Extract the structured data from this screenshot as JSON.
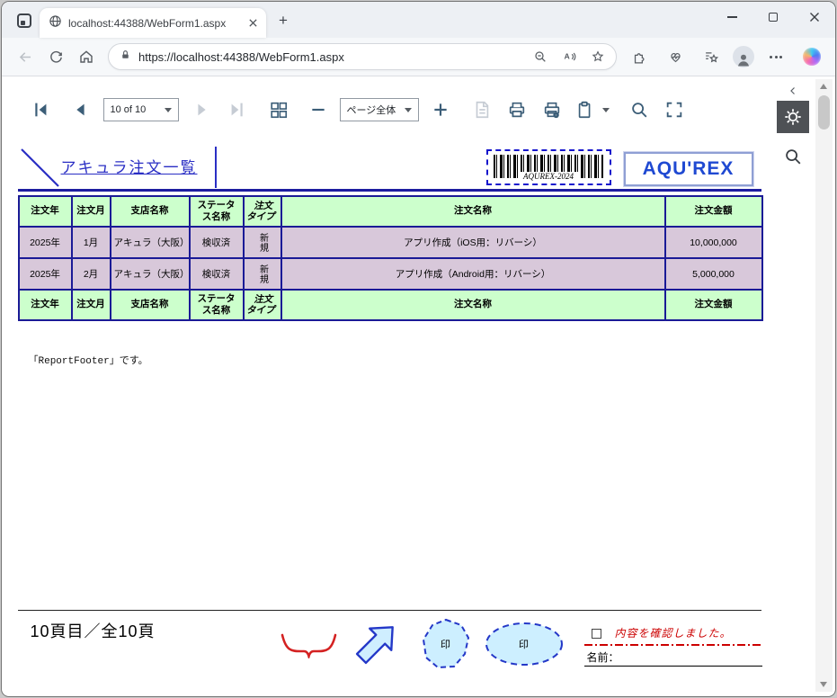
{
  "browser": {
    "tab_title": "localhost:44388/WebForm1.aspx",
    "url": "https://localhost:44388/WebForm1.aspx"
  },
  "viewer": {
    "page_select": "10 of 10",
    "zoom_select": "ページ全体"
  },
  "report": {
    "title": "アキュラ注文一覧",
    "barcode_text": "AQUREX-2024",
    "logo_text": "AQU'REX",
    "table": {
      "headers": [
        "注文年",
        "注文月",
        "支店名称",
        "ステータス名称",
        "注文タイプ",
        "注文名称",
        "注文金額"
      ],
      "type_header_lines": [
        "注文",
        "タイプ"
      ],
      "rows": [
        {
          "year": "2025年",
          "month": "1月",
          "branch": "アキュラ（大阪）",
          "status": "検収済",
          "type": "新規",
          "name": "アプリ作成（iOS用：リバーシ）",
          "amount": "10,000,000"
        },
        {
          "year": "2025年",
          "month": "2月",
          "branch": "アキュラ（大阪）",
          "status": "検収済",
          "type": "新規",
          "name": "アプリ作成（Android用：リバーシ）",
          "amount": "5,000,000"
        }
      ]
    },
    "footer_note": "「ReportFooter」です。",
    "page_indicator": "10頁目／全10頁",
    "stamps": [
      "印",
      "印"
    ],
    "confirm_label": "内容を確認しました。",
    "name_label": "名前："
  }
}
